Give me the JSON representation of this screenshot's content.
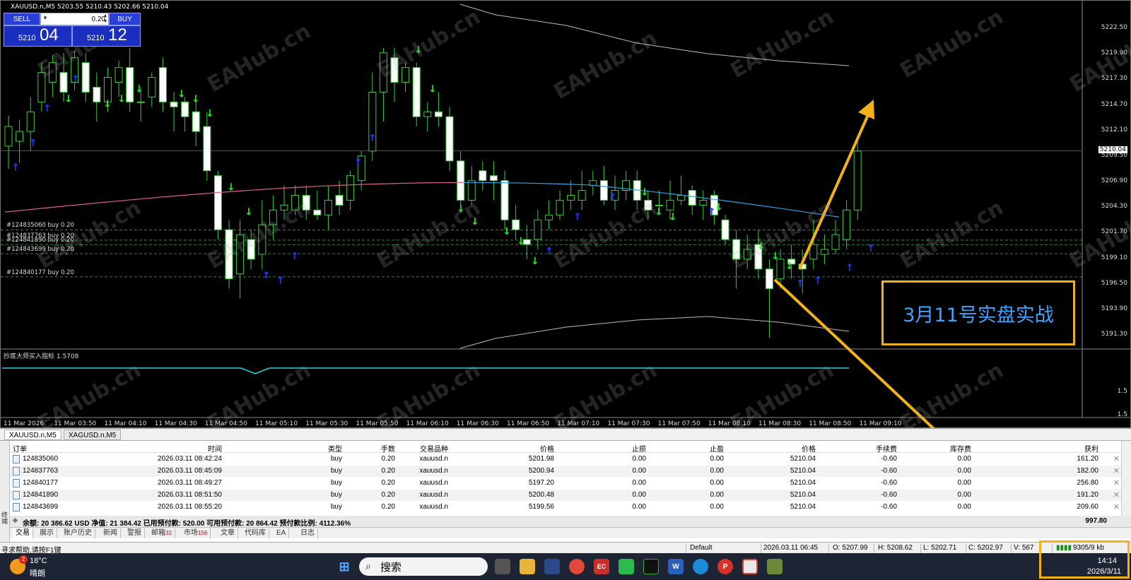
{
  "chart": {
    "title": "XAUUSD.n,M5  5203.55 5210.43 5202.66 5210.04",
    "indicator_label": "抄底大师买入指标 1.5708",
    "indicator_scale": "1.5",
    "current_price_label": "5210.04",
    "price_labels": [
      "5222.50",
      "5219.90",
      "5217.30",
      "5214.70",
      "5212.10",
      "5209.50",
      "5206.90",
      "5204.30",
      "5201.70",
      "5199.10",
      "5196.50",
      "5193.90",
      "5191.30"
    ],
    "time_labels": [
      "11 Mar 2026",
      "11 Mar 03:50",
      "11 Mar 04:10",
      "11 Mar 04:30",
      "11 Mar 04:50",
      "11 Mar 05:10",
      "11 Mar 05:30",
      "11 Mar 05:50",
      "11 Mar 06:10",
      "11 Mar 06:30",
      "11 Mar 06:50",
      "11 Mar 07:10",
      "11 Mar 07:30",
      "11 Mar 07:50",
      "11 Mar 08:10",
      "11 Mar 08:30",
      "11 Mar 08:50",
      "11 Mar 09:10"
    ],
    "order_lines": [
      "#124835060 buy 0.20",
      "#124837763 buy 0.20",
      "#124841890 buy 0.20",
      "#124843699 buy 0.20",
      "#124840177 buy 0.20"
    ],
    "watermark": "EAHub.cn"
  },
  "oneclick": {
    "sell_label": "SELL",
    "buy_label": "BUY",
    "lots": "0.20",
    "sell_small": "5210",
    "sell_big": "04",
    "buy_small": "5210",
    "buy_big": "12"
  },
  "annotation": {
    "text": "3月11号实盘实战"
  },
  "chart_tabs": [
    "XAUUSD.n,M5",
    "XAGUSD.n,M5"
  ],
  "terminal": {
    "side_label": "终端",
    "headers": [
      "订单",
      "时间",
      "类型",
      "手数",
      "交易品种",
      "价格",
      "止损",
      "止盈",
      "价格",
      "手续费",
      "库存费",
      "获利"
    ],
    "rows": [
      [
        "124835060",
        "2026.03.11 08:42:24",
        "buy",
        "0.20",
        "xauusd.n",
        "5201.98",
        "0.00",
        "0.00",
        "5210.04",
        "-0.60",
        "0.00",
        "161.20"
      ],
      [
        "124837763",
        "2026.03.11 08:45:09",
        "buy",
        "0.20",
        "xauusd.n",
        "5200.94",
        "0.00",
        "0.00",
        "5210.04",
        "-0.60",
        "0.00",
        "182.00"
      ],
      [
        "124840177",
        "2026.03.11 08:49:27",
        "buy",
        "0.20",
        "xauusd.n",
        "5197.20",
        "0.00",
        "0.00",
        "5210.04",
        "-0.60",
        "0.00",
        "256.80"
      ],
      [
        "124841890",
        "2026.03.11 08:51:50",
        "buy",
        "0.20",
        "xauusd.n",
        "5200.48",
        "0.00",
        "0.00",
        "5210.04",
        "-0.60",
        "0.00",
        "191.20"
      ],
      [
        "124843699",
        "2026.03.11 08:55:20",
        "buy",
        "0.20",
        "xauusd.n",
        "5199.56",
        "0.00",
        "0.00",
        "5210.04",
        "-0.60",
        "0.00",
        "209.60"
      ]
    ],
    "balance_text": "余额: 20 386.62 USD  净值: 21 384.42  已用预付款: 520.00  可用预付款: 20 864.42  预付款比例: 4112.36%",
    "total_profit": "997.80",
    "tabs": [
      {
        "label": "交易",
        "count": ""
      },
      {
        "label": "展示",
        "count": ""
      },
      {
        "label": "账户历史",
        "count": ""
      },
      {
        "label": "新闻",
        "count": ""
      },
      {
        "label": "警报",
        "count": ""
      },
      {
        "label": "邮箱",
        "count": "32"
      },
      {
        "label": "市场",
        "count": "156"
      },
      {
        "label": "文章",
        "count": ""
      },
      {
        "label": "代码库",
        "count": ""
      },
      {
        "label": "EA",
        "count": ""
      },
      {
        "label": "日志",
        "count": ""
      }
    ]
  },
  "statusbar": {
    "help": "寻求帮助,请按F1键",
    "profile": "Default",
    "datetime": "2026.03.11 06:45",
    "open": "O: 5207.99",
    "high": "H: 5208.62",
    "low": "L: 5202.71",
    "close": "C: 5202.97",
    "volume": "V: 567",
    "traffic": "9305/9 kb"
  },
  "taskbar": {
    "temp": "18°C",
    "weather": "晴朗",
    "weather_badge": "2",
    "search": "搜索",
    "time": "14:14",
    "date": "2026/3/11"
  },
  "colors": {
    "bull_candle": "#000000",
    "bear_candle": "#ffffff",
    "ma_line_left": "#e06090",
    "ma_line_right": "#30a0e0",
    "indicator_line": "#20d8e8",
    "annotation": "#f3b21a",
    "down_arrow": "#22ee22",
    "up_arrow": "#1a3cff"
  }
}
